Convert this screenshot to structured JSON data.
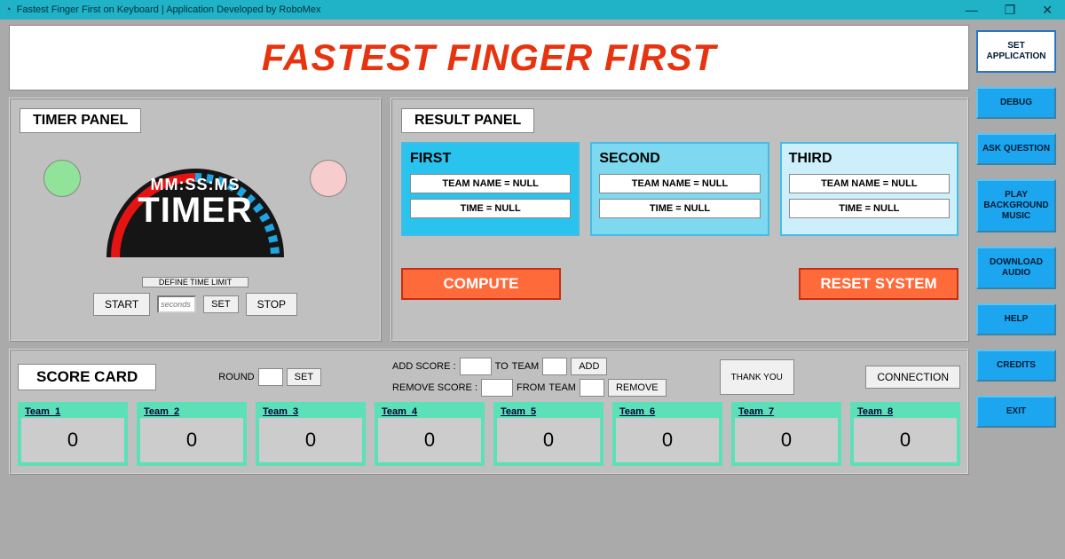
{
  "window": {
    "title": "Fastest Finger First on Keyboard | Application Developed by RoboMex",
    "min": "—",
    "max": "❐",
    "close": "✕"
  },
  "banner": "FASTEST FINGER FIRST",
  "timer": {
    "panel_title": "TIMER PANEL",
    "mm": "MM:SS:MS",
    "label": "TIMER",
    "define": "DEFINE TIME LIMIT",
    "start": "START",
    "seconds_ph": "seconds",
    "set": "SET",
    "stop": "STOP"
  },
  "result": {
    "panel_title": "RESULT PANEL",
    "cards": [
      {
        "title": "FIRST",
        "team": "TEAM NAME = NULL",
        "time": "TIME  = NULL"
      },
      {
        "title": "SECOND",
        "team": "TEAM NAME = NULL",
        "time": "TIME  = NULL"
      },
      {
        "title": "THIRD",
        "team": "TEAM NAME = NULL",
        "time": "TIME  = NULL"
      }
    ],
    "compute": "COMPUTE",
    "reset": "RESET SYSTEM"
  },
  "score": {
    "title": "SCORE CARD",
    "round_label": "ROUND",
    "set": "SET",
    "add_label": "ADD SCORE :",
    "to": "TO",
    "team": "TEAM",
    "add": "ADD",
    "remove_label": "REMOVE SCORE :",
    "from": "FROM",
    "remove": "REMOVE",
    "thank": "THANK YOU",
    "connection": "CONNECTION",
    "teams": [
      {
        "name": "Team_1",
        "val": "0"
      },
      {
        "name": "Team_2",
        "val": "0"
      },
      {
        "name": "Team_3",
        "val": "0"
      },
      {
        "name": "Team_4",
        "val": "0"
      },
      {
        "name": "Team_5",
        "val": "0"
      },
      {
        "name": "Team_6",
        "val": "0"
      },
      {
        "name": "Team_7",
        "val": "0"
      },
      {
        "name": "Team_8",
        "val": "0"
      }
    ]
  },
  "sidebar": {
    "set_app": "SET APPLICATION",
    "debug": "DEBUG",
    "ask": "ASK QUESTION",
    "music": "PLAY BACKGROUND MUSIC",
    "download": "DOWNLOAD AUDIO",
    "help": "HELP",
    "credits": "CREDITS",
    "exit": "EXIT"
  }
}
